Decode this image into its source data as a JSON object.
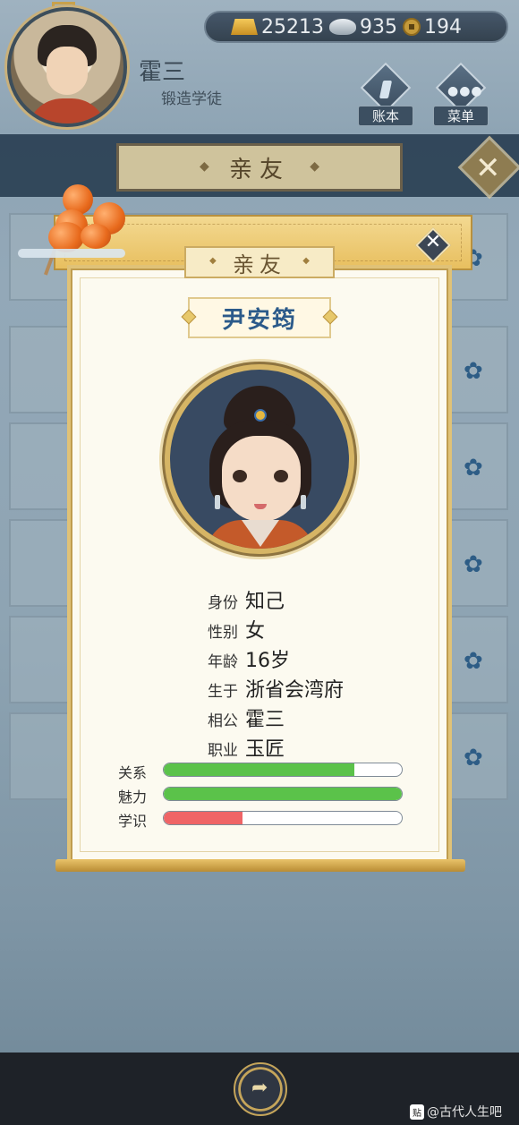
{
  "player": {
    "name": "霍三",
    "title": "锻造学徒"
  },
  "currency": {
    "gold": "25213",
    "silver": "935",
    "coin": "194"
  },
  "top_buttons": {
    "ledger_label": "账本",
    "menu_label": "菜单"
  },
  "background_panel": {
    "title": "亲友"
  },
  "modal": {
    "tab_title": "亲友",
    "person_name": "尹安筠",
    "info": [
      {
        "label": "身份",
        "value": "知己"
      },
      {
        "label": "性别",
        "value": "女"
      },
      {
        "label": "年龄",
        "value": "16岁"
      },
      {
        "label": "生于",
        "value": "浙省会湾府"
      },
      {
        "label": "相公",
        "value": "霍三"
      },
      {
        "label": "职业",
        "value": "玉匠"
      }
    ],
    "stats": [
      {
        "label": "关系",
        "level": 0.8,
        "color": "#5bc24a"
      },
      {
        "label": "魅力",
        "level": 1.0,
        "color": "#5bc24a"
      },
      {
        "label": "学识",
        "level": 0.33,
        "color": "#ef6466"
      }
    ]
  },
  "watermark": {
    "badge": "贴",
    "text": "@古代人生吧"
  },
  "colors": {
    "accent_gold": "#e0c277",
    "name_blue": "#2b5a8a",
    "bar_green": "#5bc24a",
    "bar_red": "#ef6466"
  }
}
